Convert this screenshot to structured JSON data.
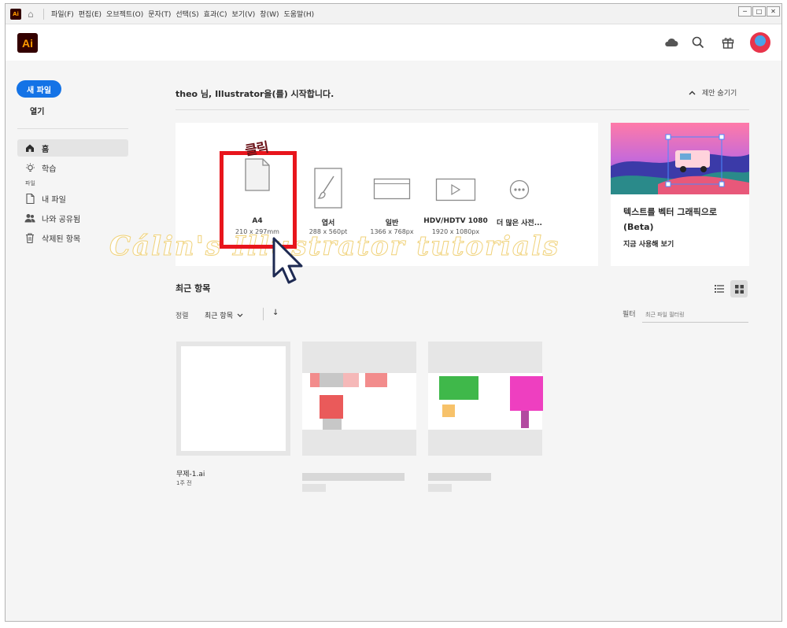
{
  "menubar": {
    "app_badge": "Ai",
    "items": [
      "파일(F)",
      "편집(E)",
      "오브젝트(O)",
      "문자(T)",
      "선택(S)",
      "효과(C)",
      "보기(V)",
      "창(W)",
      "도움말(H)"
    ],
    "window_controls": [
      "─",
      "□",
      "✕"
    ]
  },
  "header": {
    "logo": "Ai",
    "icons": [
      "cloud-icon",
      "search-icon",
      "gift-icon",
      "avatar"
    ]
  },
  "sidebar": {
    "new_file": "새 파일",
    "open": "열기",
    "nav": [
      {
        "label": "홈",
        "icon": "home-icon",
        "active": true
      },
      {
        "label": "학습",
        "icon": "lightbulb-icon"
      }
    ],
    "files_section": "파일",
    "file_nav": [
      {
        "label": "내 파일",
        "icon": "document-icon"
      },
      {
        "label": "나와 공유됨",
        "icon": "people-icon"
      },
      {
        "label": "삭제된 항목",
        "icon": "trash-icon"
      }
    ]
  },
  "main": {
    "greeting": "theo 님, Illustrator을(를) 시작합니다.",
    "hide_suggestions": "제안 숨기기",
    "presets": [
      {
        "name": "A4",
        "size": "210 x 297mm"
      },
      {
        "name": "엽서",
        "size": "288 x 560pt"
      },
      {
        "name": "일반",
        "size": "1366 x 768px"
      },
      {
        "name": "HDV/HDTV 1080",
        "size": "1920 x 1080px"
      },
      {
        "name": "더 많은 사전...",
        "size": ""
      }
    ],
    "annotation_click": "클릭",
    "watermark": "Cálin's Illustrator tutorials",
    "promo": {
      "title": "텍스트를 벡터 그래픽으로(Beta)",
      "link": "지금 사용해 보기"
    },
    "recent": {
      "title": "최근 항목",
      "sort_label": "정렬",
      "sort_value": "최근 항목",
      "sort_direction": "↓",
      "filter_label": "필터",
      "filter_placeholder": "최근 파일 필터링",
      "files": [
        {
          "name": "무제-1.ai",
          "time": "1주 전"
        }
      ]
    }
  },
  "colors": {
    "accent": "#1473e6",
    "highlight": "#e8151c",
    "ai_logo_bg": "#330000",
    "ai_logo_fg": "#ff9a00"
  }
}
